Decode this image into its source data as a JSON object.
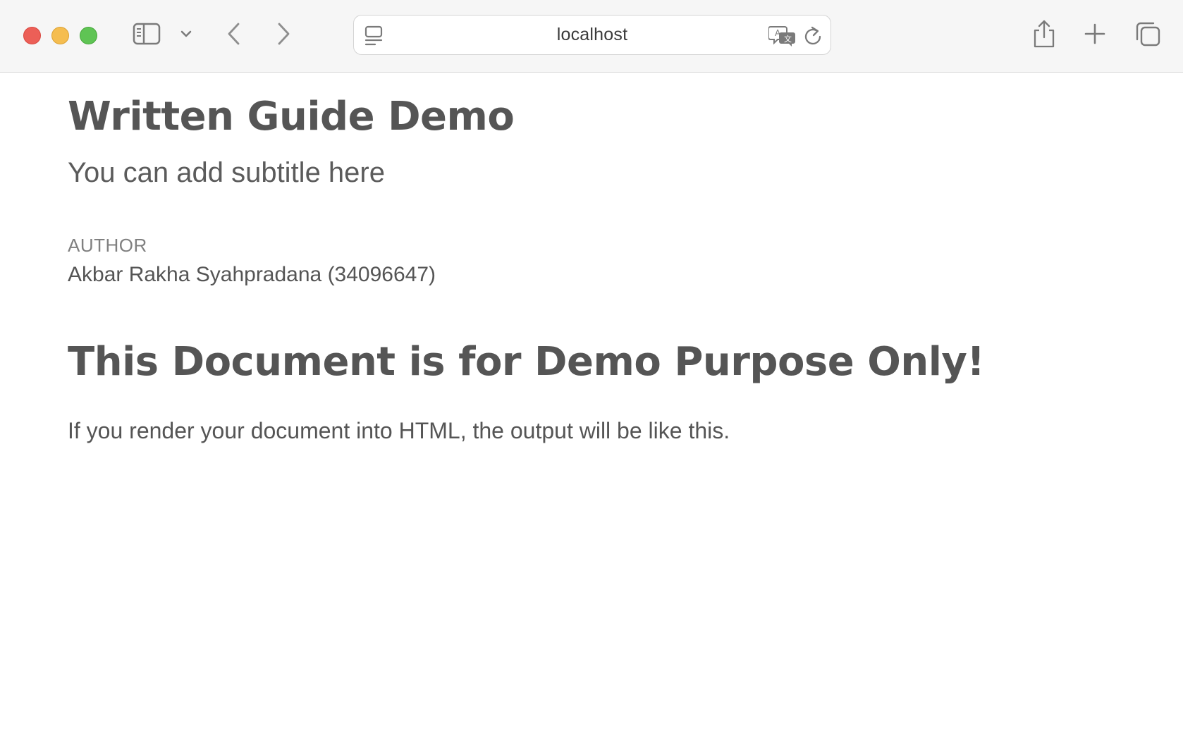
{
  "browser": {
    "url": "localhost",
    "traffic_lights": {
      "close_color": "#ec5f57",
      "minimize_color": "#f5bd4f",
      "maximize_color": "#5fc454"
    },
    "icons": {
      "sidebar": "sidebar-icon",
      "sidebar_chevron": "chevron-down-icon",
      "back": "chevron-left-icon",
      "forward": "chevron-right-icon",
      "page_menu": "page-menu-icon",
      "translate": "translate-icon",
      "reload": "reload-icon",
      "share": "share-icon",
      "new_tab": "plus-icon",
      "tab_overview": "tab-overview-icon"
    }
  },
  "document": {
    "title": "Written Guide Demo",
    "subtitle": "You can add subtitle here",
    "author_label": "AUTHOR",
    "author_name": "Akbar Rakha Syahpradana (34096647)",
    "section_heading": "This Document is for Demo Purpose Only!",
    "body_text": "If you render your document into HTML, the output will be like this.",
    "text_color": "#555555"
  }
}
